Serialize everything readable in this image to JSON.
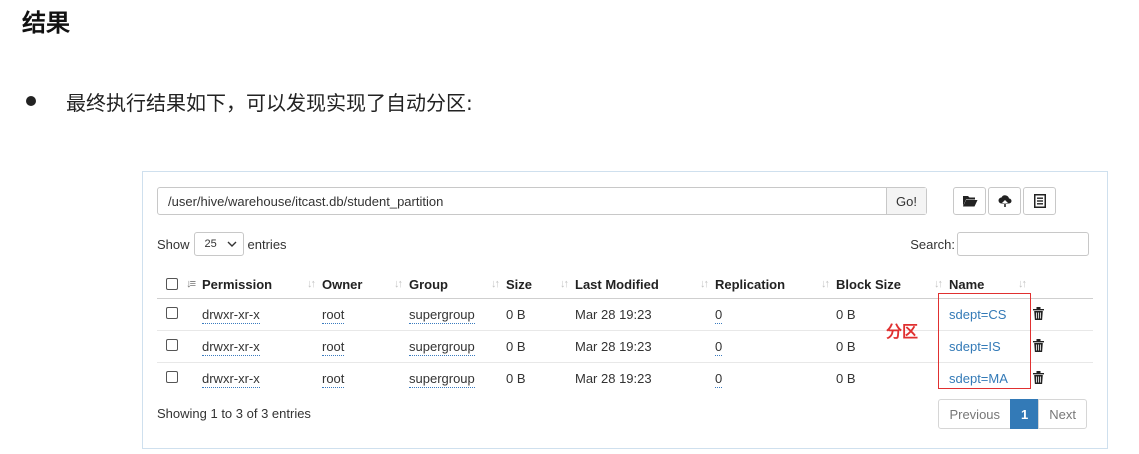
{
  "heading": "结果",
  "bullet": "最终执行结果如下，可以发现实现了自动分区:",
  "browser": {
    "path": "/user/hive/warehouse/itcast.db/student_partition",
    "go_label": "Go!",
    "toolbar_icons": [
      "folder-open-icon",
      "upload-icon",
      "list-icon"
    ],
    "show_label": "Show",
    "page_size": "25",
    "entries_label": "entries",
    "search_label": "Search:",
    "search_value": "",
    "columns": [
      "Permission",
      "Owner",
      "Group",
      "Size",
      "Last Modified",
      "Replication",
      "Block Size",
      "Name"
    ],
    "rows": [
      {
        "permission": "drwxr-xr-x",
        "owner": "root",
        "group": "supergroup",
        "size": "0 B",
        "modified": "Mar 28 19:23",
        "replication": "0",
        "block_size": "0 B",
        "name": "sdept=CS"
      },
      {
        "permission": "drwxr-xr-x",
        "owner": "root",
        "group": "supergroup",
        "size": "0 B",
        "modified": "Mar 28 19:23",
        "replication": "0",
        "block_size": "0 B",
        "name": "sdept=IS"
      },
      {
        "permission": "drwxr-xr-x",
        "owner": "root",
        "group": "supergroup",
        "size": "0 B",
        "modified": "Mar 28 19:23",
        "replication": "0",
        "block_size": "0 B",
        "name": "sdept=MA"
      }
    ],
    "info": "Showing 1 to 3 of 3 entries",
    "pager": {
      "prev": "Previous",
      "current": "1",
      "next": "Next"
    }
  },
  "annotation": {
    "label": "分区",
    "color": "#e03030"
  },
  "colors": {
    "link": "#337ab7",
    "border": "#cfe0ee"
  }
}
